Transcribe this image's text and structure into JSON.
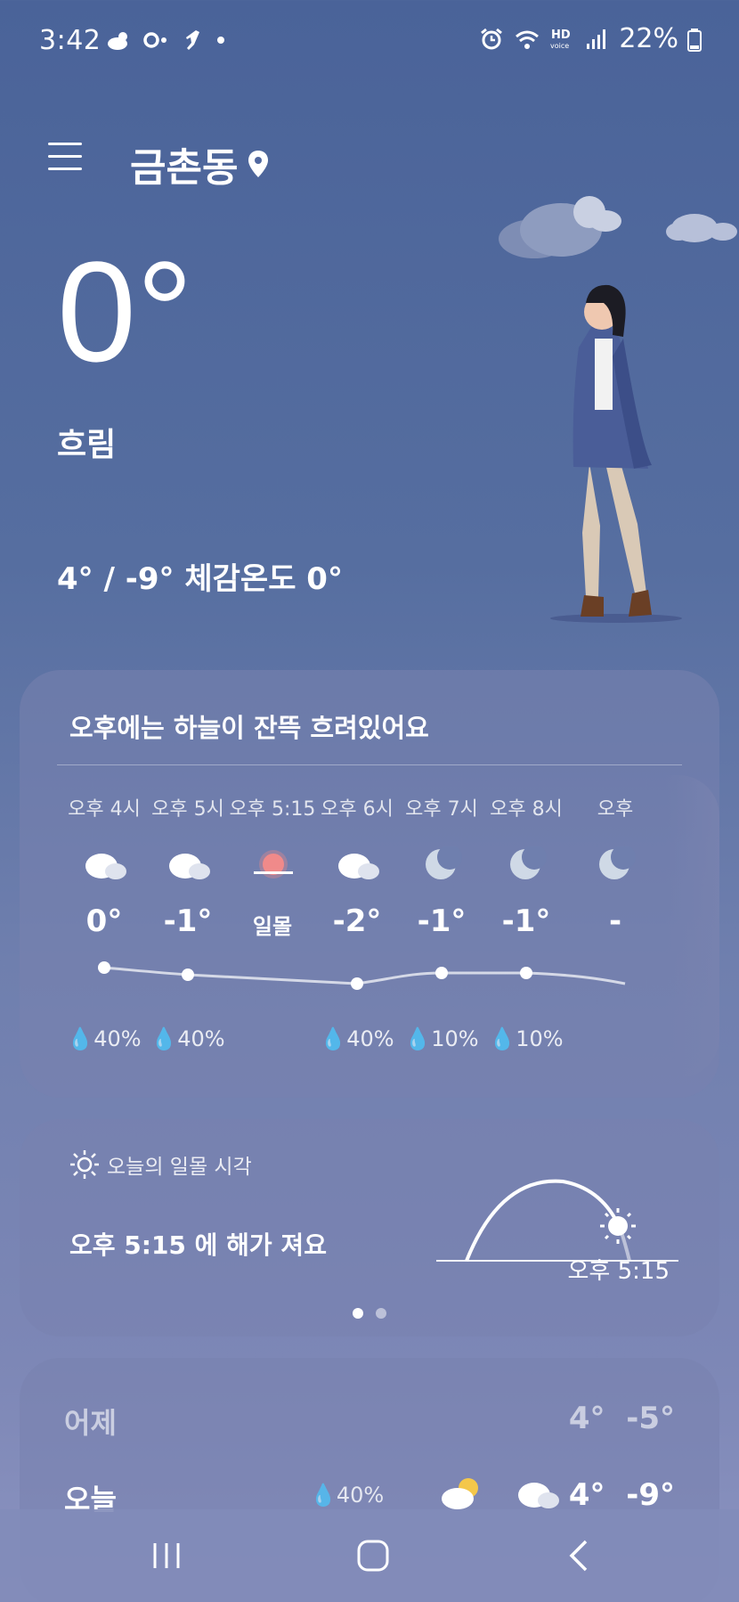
{
  "status_bar": {
    "time": "3:42",
    "battery": "22%",
    "hd_label": "HD",
    "hd_sub": "voice"
  },
  "header": {
    "location": "금촌동"
  },
  "current": {
    "temp": "0°",
    "condition": "흐림",
    "hi_lo_feels": "4° / -9° 체감온도 0°"
  },
  "hourly_card": {
    "summary": "오후에는 하늘이 잔뜩 흐려있어요",
    "hours": [
      {
        "label": "오후 4시",
        "temp": "0°",
        "icon": "cloud-icon",
        "rain": "40%"
      },
      {
        "label": "오후 5시",
        "temp": "-1°",
        "icon": "cloud-icon",
        "rain": "40%"
      },
      {
        "label": "오후 5:15",
        "temp": "일몰",
        "icon": "sunset-icon",
        "rain": ""
      },
      {
        "label": "오후 6시",
        "temp": "-2°",
        "icon": "cloud-icon",
        "rain": "40%"
      },
      {
        "label": "오후 7시",
        "temp": "-1°",
        "icon": "moon-icon",
        "rain": "10%"
      },
      {
        "label": "오후 8시",
        "temp": "-1°",
        "icon": "moon-icon",
        "rain": "10%"
      },
      {
        "label": "오후",
        "temp": "-",
        "icon": "moon-icon",
        "rain": ""
      }
    ]
  },
  "sunset_card": {
    "label": "오늘의 일몰 시각",
    "text": "오후 5:15 에 해가 져요",
    "time": "오후 5:15"
  },
  "daily_card": {
    "rows": [
      {
        "name": "어제",
        "hi": "4°",
        "lo": "-5°"
      },
      {
        "name": "오늘",
        "rain": "40%",
        "hi": "4°",
        "lo": "-9°"
      }
    ]
  }
}
